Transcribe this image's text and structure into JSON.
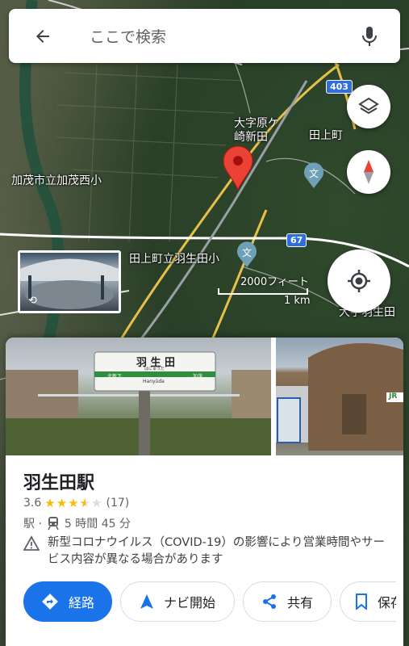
{
  "search": {
    "placeholder": "ここで検索"
  },
  "map": {
    "labels": {
      "oaza": "大字原ケ\n崎新田",
      "taue": "田上町",
      "kamo": "加茂市立加茂西小",
      "school": "田上町立羽生田小",
      "oaza2": "大字羽生田"
    },
    "routes": {
      "r403": "403",
      "r67": "67"
    },
    "scale": {
      "feet": "2000フィート",
      "km": "1 km"
    }
  },
  "place": {
    "title": "羽生田駅",
    "rating": "3.6",
    "review_count": "(17)",
    "stars_filled": 3.5,
    "type": "駅 ·",
    "transit": "5 時間 45 分",
    "notice": "新型コロナウイルス（COVID-19）の影響により営業時間やサービス内容が異なる場合があります",
    "photo_sign": {
      "name": "羽 生 田",
      "kana": "はにゅうだ",
      "roman": "Hanyūda",
      "left": "北新下",
      "right": "加茂"
    },
    "jr_mark": "JR"
  },
  "actions": {
    "directions": "経路",
    "navigate": "ナビ開始",
    "share": "共有",
    "save": "保存"
  },
  "icons": [
    "back-arrow-icon",
    "mic-icon",
    "layers-icon",
    "compass-icon",
    "my-location-icon",
    "directions-icon",
    "navigation-icon",
    "share-icon",
    "bookmark-icon",
    "warning-icon",
    "train-icon",
    "school-icon",
    "map-pin-icon",
    "360-icon"
  ],
  "colors": {
    "accent": "#1a73e8",
    "pin": "#ea4335",
    "star": "#fbbc04"
  }
}
